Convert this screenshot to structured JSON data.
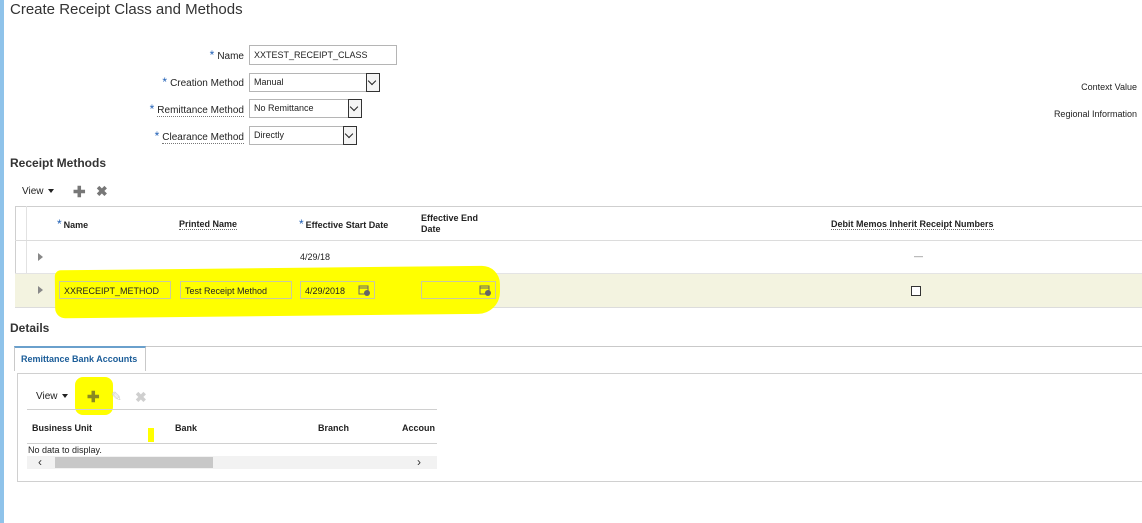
{
  "page": {
    "title": "Create Receipt Class and Methods"
  },
  "form": {
    "name": {
      "label": "Name",
      "value": "XXTEST_RECEIPT_CLASS"
    },
    "creation_method": {
      "label": "Creation Method",
      "value": "Manual"
    },
    "remittance_method": {
      "label": "Remittance Method",
      "value": "No Remittance"
    },
    "clearance_method": {
      "label": "Clearance Method",
      "value": "Directly"
    },
    "context_value_label": "Context Value",
    "regional_info_label": "Regional Information",
    "required_marker": "*"
  },
  "receipt_methods": {
    "title": "Receipt Methods",
    "toolbar": {
      "view": "View"
    },
    "columns": {
      "name": "Name",
      "printed_name": "Printed Name",
      "start_date": "Effective Start Date",
      "end_date_line1": "Effective End",
      "end_date_line2": "Date",
      "debit_memos": "Debit Memos Inherit Receipt Numbers"
    },
    "rows": [
      {
        "name": "",
        "printed_name": "",
        "start_date": "4/29/18",
        "end_date": "",
        "debit": "—"
      },
      {
        "name": "XXRECEIPT_METHOD",
        "printed_name": "Test Receipt Method",
        "start_date": "4/29/2018",
        "end_date": "",
        "debit_checked": false
      }
    ],
    "highlight_color": "#ffff00"
  },
  "details": {
    "title": "Details",
    "tab": "Remittance Bank Accounts",
    "toolbar": {
      "view": "View"
    },
    "columns": {
      "business_unit": "Business Unit",
      "bank": "Bank",
      "branch": "Branch",
      "account": "Accoun"
    },
    "empty": "No data to display."
  },
  "icons": {
    "add": "plus-icon",
    "delete": "x-icon",
    "edit": "pencil-icon",
    "calendar": "calendar-icon",
    "dropdown": "chevron-down-icon",
    "expand": "triangle-right-icon",
    "scroll_left": "chevron-left-icon",
    "scroll_right": "chevron-right-icon"
  }
}
